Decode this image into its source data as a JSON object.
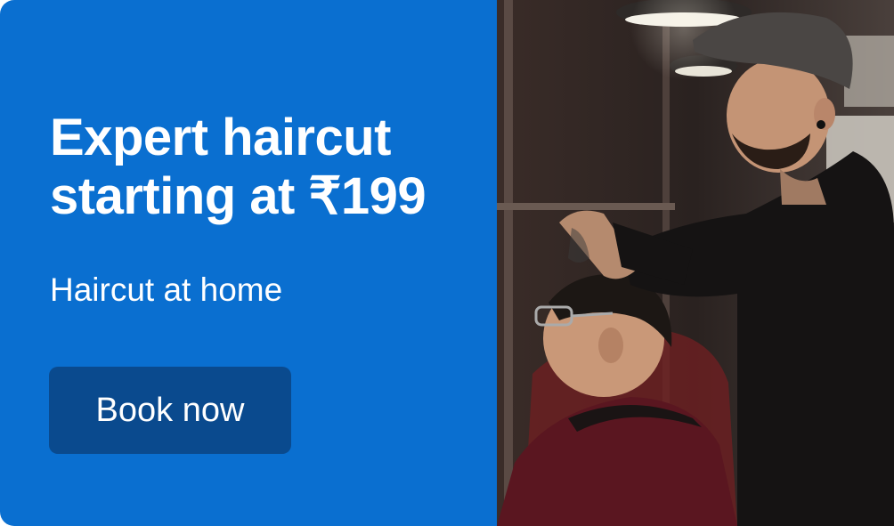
{
  "promo": {
    "headline_line1": "Expert haircut",
    "headline_line2": "starting at ₹199",
    "subtitle": "Haircut at home",
    "cta_label": "Book now"
  },
  "photo": {
    "description_icon": "barber-photo"
  },
  "colors": {
    "panel_bg": "#0a6fd0",
    "button_bg": "#0a4a8e",
    "text": "#ffffff"
  }
}
